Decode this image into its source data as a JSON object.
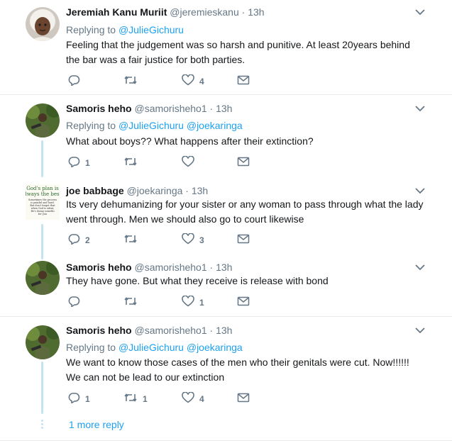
{
  "tweets": [
    {
      "name": "Jeremiah Kanu Muriit",
      "handle": "@jeremieskanu",
      "time": "13h",
      "replying_label": "Replying to",
      "mentions": [
        "@JulieGichuru"
      ],
      "lines": [
        "Feeling that the judgement was so harsh and punitive. At least 20years behind",
        "the bar was a fair justice for both parties."
      ],
      "reply_count": "",
      "retweet_count": "",
      "like_count": "4"
    },
    {
      "name": "Samoris heho",
      "handle": "@samorisheho1",
      "time": "13h",
      "replying_label": "Replying to",
      "mentions": [
        "@JulieGichuru",
        "@joekaringa"
      ],
      "lines": [
        "What about boys?? What happens after their extinction?"
      ],
      "reply_count": "1",
      "retweet_count": "",
      "like_count": ""
    },
    {
      "name": "joe babbage",
      "handle": "@joekaringa",
      "time": "13h",
      "replying_label": "",
      "mentions": [],
      "lines": [
        "Its very dehumanizing for your sister or any woman to pass through what the lady",
        "went through. Men we should also go to court likewise"
      ],
      "reply_count": "2",
      "retweet_count": "",
      "like_count": "3",
      "avatar_text": [
        "God's plan is",
        "always the best.",
        "Sometimes the process",
        "is painful and hard.",
        "But don't forget that",
        "when God is silent,",
        "He's doing somethi",
        "for you"
      ]
    },
    {
      "name": "Samoris heho",
      "handle": "@samorisheho1",
      "time": "13h",
      "replying_label": "",
      "mentions": [],
      "lines": [
        "They have gone. But what they receive is release with bond"
      ],
      "reply_count": "",
      "retweet_count": "",
      "like_count": "1"
    },
    {
      "name": "Samoris heho",
      "handle": "@samorisheho1",
      "time": "13h",
      "replying_label": "Replying to",
      "mentions": [
        "@JulieGichuru",
        "@joekaringa"
      ],
      "lines": [
        "We want to know those cases of the men who  their genitals were cut. Now!!!!!!",
        "We can not be lead to our extinction"
      ],
      "reply_count": "1",
      "retweet_count": "1",
      "like_count": "4"
    }
  ],
  "dot": "·",
  "more_reply_label": "1 more reply",
  "icons": {
    "reply": "reply-icon",
    "retweet": "retweet-icon",
    "like": "heart-icon",
    "dm": "envelope-icon",
    "menu": "chevron-down-icon"
  },
  "colors": {
    "link": "#1da1f2",
    "muted": "#657786",
    "thread": "#c4e3f3",
    "divider": "#e6ecf0"
  }
}
